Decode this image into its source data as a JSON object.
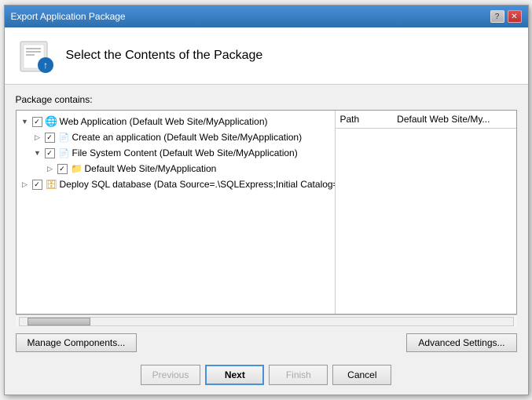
{
  "dialog": {
    "title": "Export Application Package",
    "header_title": "Select the Contents of the Package",
    "package_label": "Package contains:",
    "tree_items": [
      {
        "id": "web-app",
        "level": 1,
        "expanded": true,
        "checked": true,
        "icon": "globe",
        "text": "Web Application (Default Web Site/MyApplication)"
      },
      {
        "id": "create-app",
        "level": 2,
        "expanded": false,
        "checked": true,
        "icon": "app",
        "text": "Create an application (Default Web Site/MyApplication)"
      },
      {
        "id": "fs-content",
        "level": 2,
        "expanded": true,
        "checked": true,
        "icon": "app",
        "text": "File System Content (Default Web Site/MyApplication)"
      },
      {
        "id": "default-site",
        "level": 3,
        "expanded": false,
        "checked": true,
        "icon": "folder",
        "text": "Default Web Site/MyApplication"
      },
      {
        "id": "deploy-sql",
        "level": 1,
        "expanded": false,
        "checked": true,
        "icon": "db",
        "text": "Deploy SQL database (Data Source=.\\SQLExpress;Initial Catalog=..."
      }
    ],
    "right_panel": {
      "col1": "Path",
      "col2": "Default Web Site/My..."
    },
    "manage_btn": "Manage Components...",
    "advanced_btn": "Advanced Settings...",
    "previous_btn": "Previous",
    "next_btn": "Next",
    "finish_btn": "Finish",
    "cancel_btn": "Cancel"
  }
}
